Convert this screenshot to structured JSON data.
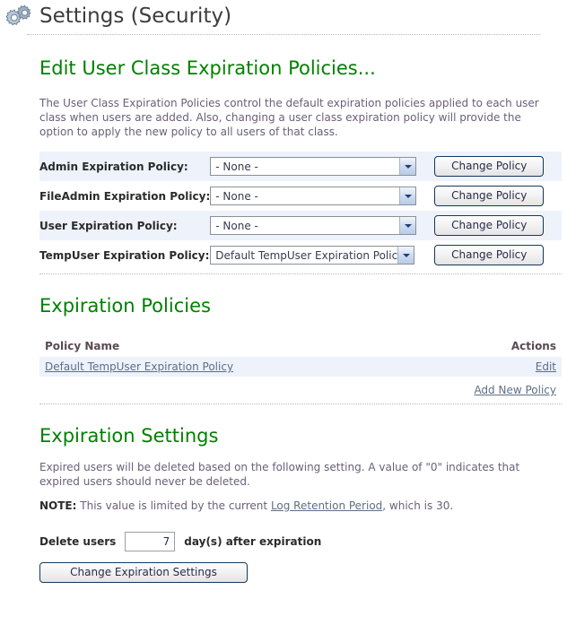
{
  "header": {
    "title": "Settings (Security)",
    "icon": "gears-icon"
  },
  "edit_section": {
    "heading": "Edit User Class Expiration Policies...",
    "description": "The User Class Expiration Policies control the default expiration policies applied to each user class when users are added. Also, changing a user class expiration policy will provide the option to apply the new policy to all users of that class.",
    "rows": [
      {
        "label": "Admin Expiration Policy:",
        "value": "- None -",
        "button": "Change Policy"
      },
      {
        "label": "FileAdmin Expiration Policy:",
        "value": "- None -",
        "button": "Change Policy"
      },
      {
        "label": "User Expiration Policy:",
        "value": "- None -",
        "button": "Change Policy"
      },
      {
        "label": "TempUser Expiration Policy:",
        "value": "Default TempUser Expiration Policy",
        "button": "Change Policy"
      }
    ]
  },
  "policies_section": {
    "heading": "Expiration Policies",
    "columns": {
      "name": "Policy Name",
      "actions": "Actions"
    },
    "rows": [
      {
        "name": "Default TempUser Expiration Policy",
        "action": "Edit"
      }
    ],
    "add_link": "Add New Policy"
  },
  "settings_section": {
    "heading": "Expiration Settings",
    "description": "Expired users will be deleted based on the following setting. A value of \"0\" indicates that expired users should never be deleted.",
    "note_label": "NOTE:",
    "note_text_before": " This value is limited by the current ",
    "note_link": "Log Retention Period",
    "note_text_after": ", which is 30.",
    "delete_label_before": "Delete users",
    "delete_value": "7",
    "delete_label_after": "day(s) after expiration",
    "submit_button": "Change Expiration Settings"
  },
  "colors": {
    "heading_green": "#008000",
    "title_gray": "#3c3c3c",
    "body_purple": "#6b5f78",
    "link_slate": "#5c6f86",
    "row_alt": "#eef2fb",
    "button_border": "#17365c"
  }
}
